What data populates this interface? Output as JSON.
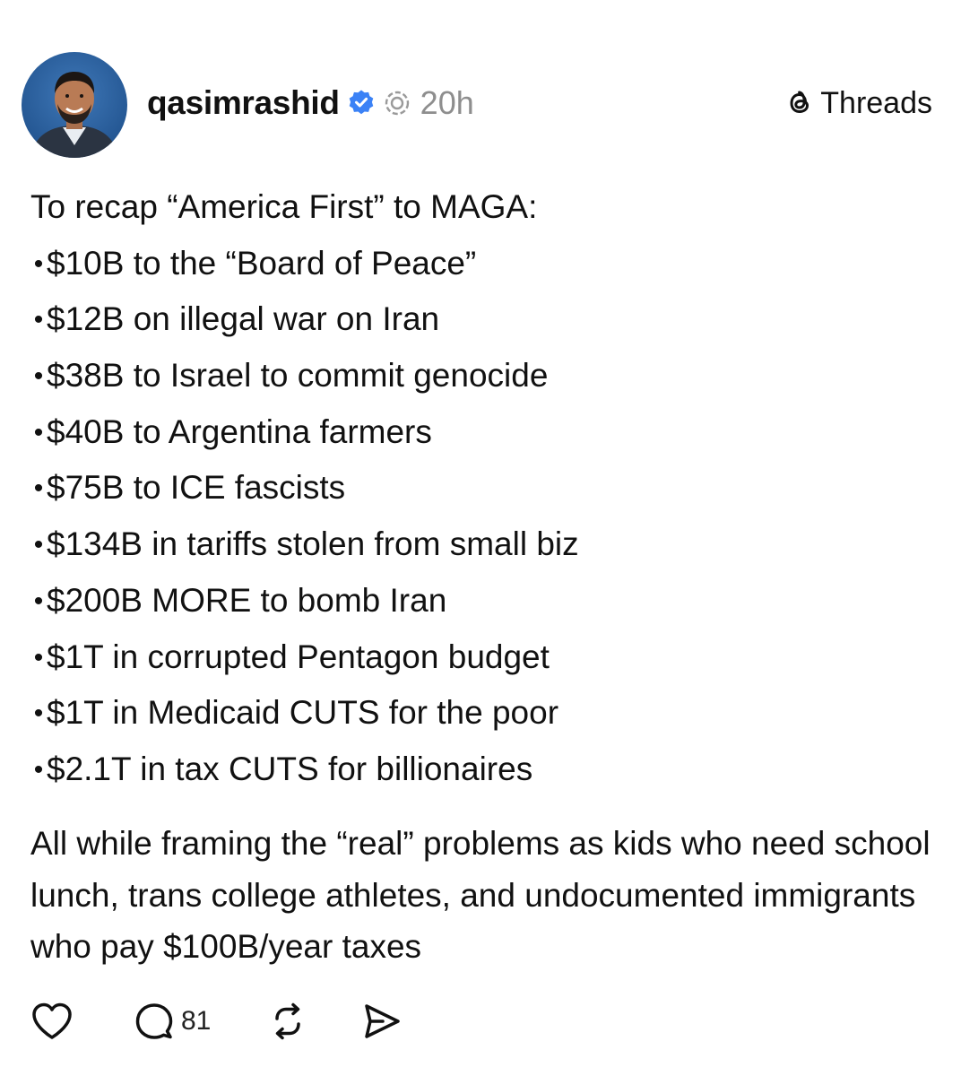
{
  "post": {
    "author": {
      "username": "qasimrashid",
      "verified": true,
      "time_ago": "20h"
    },
    "brand_label": "Threads",
    "intro": "To recap “America First” to MAGA:",
    "bullets": [
      "$10B to the “Board of Peace”",
      "$12B on illegal war on Iran",
      "$38B to Israel to commit genocide",
      "$40B to Argentina farmers",
      "$75B to ICE fascists",
      "$134B in tariffs stolen from small biz",
      "$200B MORE to bomb Iran",
      "$1T in corrupted Pentagon budget",
      "$1T in Medicaid CUTS for the poor",
      "$2.1T in tax CUTS for billionaires"
    ],
    "bullet_char": "•",
    "closing": "All while framing the “real” problems as kids who need school lunch, trans college athletes, and undocumented immigrants who pay $100B/year taxes",
    "actions": {
      "reply_count": "81"
    }
  },
  "icons": {
    "verified": "verified-badge-icon",
    "pending": "pending-icon",
    "brand": "threads-logo-icon",
    "like": "heart-icon",
    "reply": "comment-icon",
    "repost": "repost-icon",
    "share": "send-icon"
  },
  "colors": {
    "verified_blue": "#3b82f6",
    "muted_gray": "#8e8e8e",
    "text": "#111111",
    "background": "#ffffff"
  }
}
